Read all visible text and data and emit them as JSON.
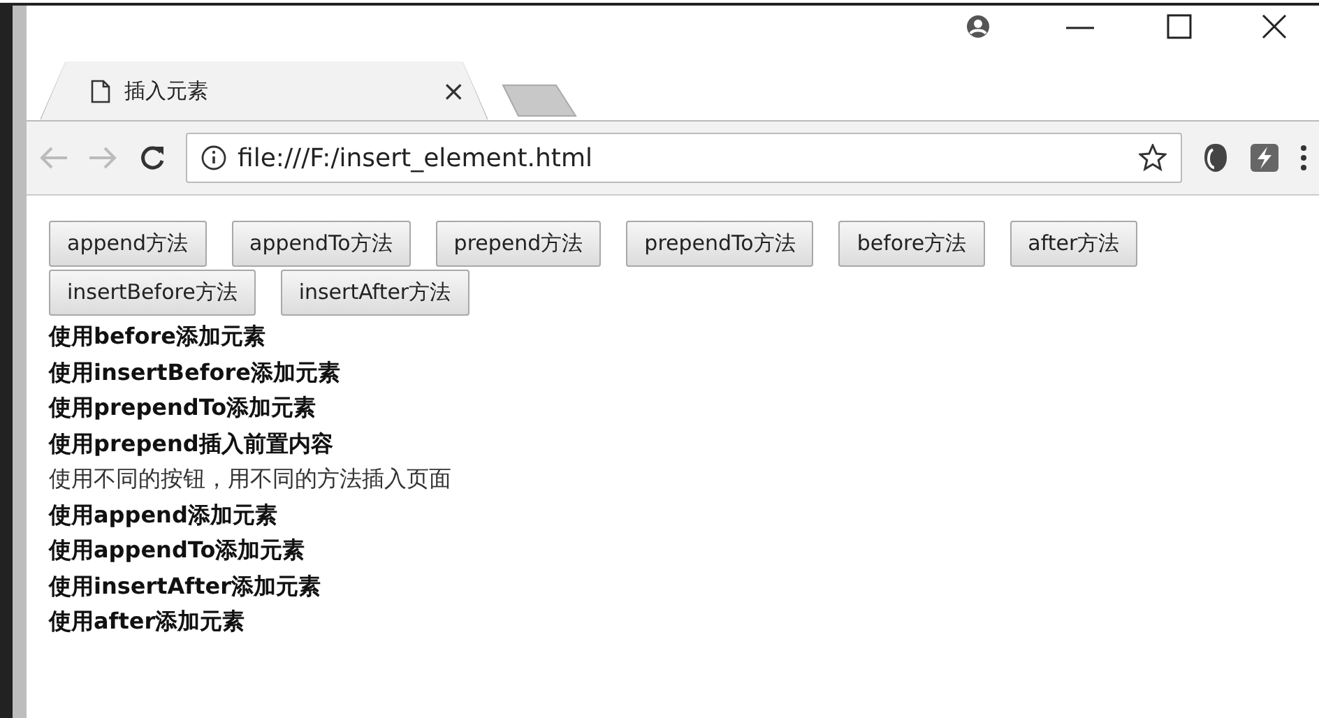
{
  "tab": {
    "title": "插入元素",
    "close": "×"
  },
  "address": "file:///F:/insert_element.html",
  "buttons": [
    {
      "label": "append方法"
    },
    {
      "label": "appendTo方法"
    },
    {
      "label": "prepend方法"
    },
    {
      "label": "prependTo方法"
    },
    {
      "label": "before方法"
    },
    {
      "label": "after方法"
    },
    {
      "label": "insertBefore方法"
    },
    {
      "label": "insertAfter方法"
    }
  ],
  "lines": [
    {
      "text": "使用before添加元素",
      "bold": true
    },
    {
      "text": "使用insertBefore添加元素",
      "bold": true
    },
    {
      "text": "使用prependTo添加元素",
      "bold": true
    },
    {
      "text": "使用prepend插入前置内容",
      "bold": true
    },
    {
      "text": "使用不同的按钮，用不同的方法插入页面",
      "bold": false
    },
    {
      "text": "使用append添加元素",
      "bold": true
    },
    {
      "text": "使用appendTo添加元素",
      "bold": true
    },
    {
      "text": "使用insertAfter添加元素",
      "bold": true
    },
    {
      "text": "使用after添加元素",
      "bold": true
    }
  ]
}
